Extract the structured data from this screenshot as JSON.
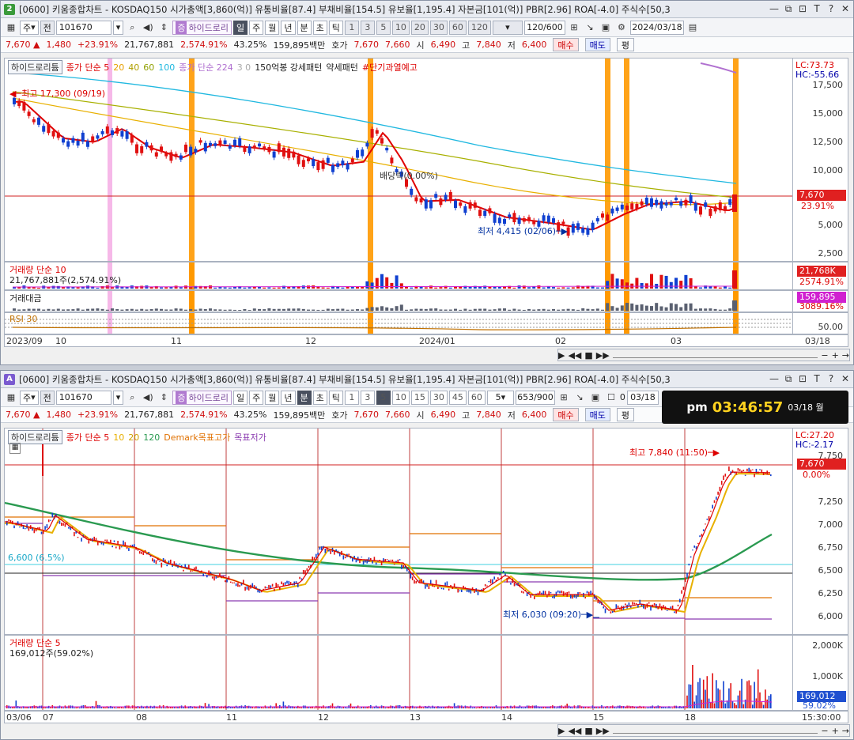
{
  "stock": {
    "window_title": "[0600] 키움종합차트 - KOSDAQ150 시가총액[3,860(억)] 유통비율[87.4] 부채비율[154.5] 유보율[1,195.4] 자본금[101(억)] PBR[2.96] ROA[-4.0] 주식수[50,3",
    "code": "101670",
    "price": "7,670",
    "change": "1,480",
    "change_pct": "+23.91%",
    "volume": "21,767,881",
    "volume_ratio": "2,574.91%",
    "turnover": "43.25%",
    "amount": "159,895백만",
    "hoga_label": "호가",
    "ask": "7,670",
    "bid": "7,660",
    "open_label": "시",
    "open": "6,490",
    "high_label": "고",
    "high": "7,840",
    "low_label": "저",
    "low": "6,400",
    "buy": "매수",
    "sell": "매도",
    "avg": "평",
    "up_symbol": "▲"
  },
  "top": {
    "icon": "2",
    "period_tabs": [
      "주",
      "전"
    ],
    "indicator": "하이드로리",
    "tf": [
      "일",
      "주",
      "월",
      "년",
      "분",
      "초",
      "틱"
    ],
    "nums": [
      "1",
      "3",
      "5",
      "10",
      "20",
      "30",
      "60",
      "120"
    ],
    "count": "120/600",
    "date": "2024/03/18",
    "legend": {
      "name": "하이드로리튬",
      "ma": "종가 단순 5",
      "ma20": "20",
      "ma40": "40",
      "ma60": "60",
      "ma100": "100",
      "ma224": "종가 단순 224",
      "ma224b": "3 0",
      "pattern": "150억봉 강세패턴",
      "weak": "약세패턴",
      "warn": "#단기과열예고"
    },
    "lc": "LC:73.73",
    "hc": "HC:-55.66",
    "yticks": [
      "17,500",
      "15,000",
      "12,500",
      "10,000",
      "7,500",
      "5,000",
      "2,500"
    ],
    "price_tag": "7,670",
    "pct_tag": "23.91%",
    "high_note": "최고 17,300 (09/19)",
    "low_note": "최저 4,415 (02/06)",
    "div_note": "배당락(0.00%)",
    "vol_legend": "거래량 단순 10",
    "vol_text": "21,767,881주(2,574.91%)",
    "vol_tag": "21,768K",
    "vol_pct": "2574.91%",
    "amt_legend": "거래대금",
    "amt_tag": "159,895",
    "amt_pct": "3089.16%",
    "rsi_legend": "RSI 30",
    "rsi_tick": "50.00",
    "xticks": [
      "2023/09",
      "10",
      "11",
      "12",
      "2024/01",
      "02",
      "03"
    ],
    "xdate": "03/18"
  },
  "bottom": {
    "icon": "A",
    "period_tabs": [
      "주",
      "전"
    ],
    "indicator": "하이드로리",
    "tf": [
      "일",
      "주",
      "월",
      "년",
      "분",
      "초",
      "틱"
    ],
    "nums": [
      "1",
      "3",
      "5",
      "10",
      "15",
      "30",
      "45",
      "60"
    ],
    "interval": "5",
    "count": "653/900",
    "zero": "0",
    "date": "03/18",
    "clock_ampm": "pm",
    "clock_time": "03:46:57",
    "clock_date": "03/18 월",
    "legend": {
      "name": "하이드로리튬",
      "ma": "종가 단순 5",
      "ma10": "10",
      "ma20": "20",
      "ma120": "120",
      "demark": "Demark목표고가",
      "target_low": "목표저가"
    },
    "lc": "LC:27.20",
    "hc": "HC:-2.17",
    "yticks": [
      "7,750",
      "7,500",
      "7,250",
      "7,000",
      "6,750",
      "6,500",
      "6,250",
      "6,000"
    ],
    "price_tag": "7,670",
    "pct_tag": "0.00%",
    "high_note": "최고 7,840 (11:50)",
    "low_note": "최저 6,030 (09:20)",
    "level_note": "6,600 (6.5%)",
    "vol_legend": "거래량 단순 5",
    "vol_text": "169,012주(59.02%)",
    "vol_ticks": [
      "2,000K",
      "1,000K"
    ],
    "vol_tag": "169,012",
    "vol_pct": "59.02%",
    "xticks": [
      "03/06",
      "07",
      "08",
      "11",
      "12",
      "13",
      "14",
      "15",
      "18"
    ],
    "xtime": "15:30:00"
  },
  "colors": {
    "up": "#e01010",
    "down": "#1040d0",
    "orange": "#ff9900",
    "ma_red": "#e00000",
    "ma_yellow": "#e8b000",
    "ma_green": "#2a9a50",
    "ma_cyan": "#20b8e0"
  },
  "icons": [
    "minimize-icon",
    "restore-icon",
    "pin-icon",
    "font-icon",
    "help-icon",
    "close-icon"
  ]
}
